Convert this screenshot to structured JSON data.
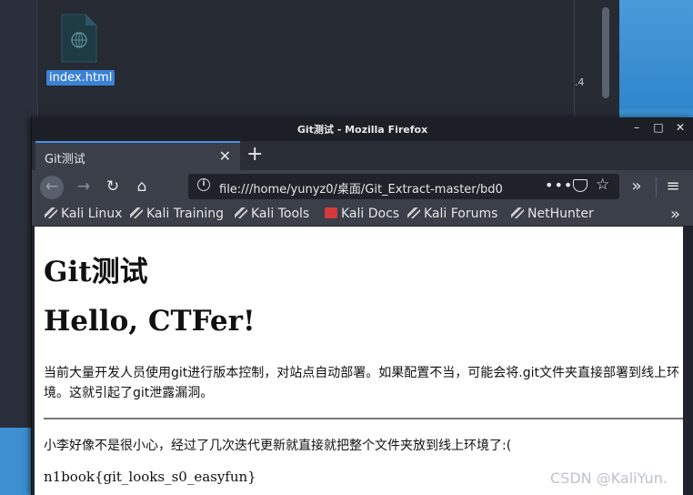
{
  "desktop": {
    "file_label": "index.html",
    "side_text": ".4"
  },
  "window": {
    "title": "Git测试 - Mozilla Firefox",
    "controls": {
      "minimize": "–",
      "maximize": "□",
      "close": "✕"
    }
  },
  "tabs": [
    {
      "label": "Git测试",
      "active": true
    }
  ],
  "tabbar": {
    "close_glyph": "✕",
    "new_tab_glyph": "+"
  },
  "navbar": {
    "back_glyph": "←",
    "forward_glyph": "→",
    "reload_glyph": "↻",
    "home_glyph": "⌂",
    "url": "file:///home/yunyz0/桌面/Git_Extract-master/bd0",
    "info_glyph": "i",
    "dots": "•••",
    "star_glyph": "☆",
    "overflow_glyph": "»",
    "menu_glyph": "≡"
  },
  "bookmarks": [
    {
      "label": "Kali Linux",
      "icon": "kali-dragon-icon"
    },
    {
      "label": "Kali Training",
      "icon": "kali-dragon-icon"
    },
    {
      "label": "Kali Tools",
      "icon": "kali-dragon-icon"
    },
    {
      "label": "Kali Docs",
      "icon": "kali-docs-icon"
    },
    {
      "label": "Kali Forums",
      "icon": "kali-dragon-icon"
    },
    {
      "label": "NetHunter",
      "icon": "kali-dragon-icon"
    }
  ],
  "bookmarks_more_glyph": "»",
  "page": {
    "heading1": "Git测试",
    "heading2": "Hello, CTFer!",
    "intro": "当前大量开发人员使用git进行版本控制，对站点自动部署。如果配置不当，可能会将.git文件夹直接部署到线上环境。这就引起了git泄露漏洞。",
    "note": "小李好像不是很小心，经过了几次迭代更新就直接就把整个文件夹放到线上环境了:(",
    "flag": "n1book{git_looks_s0_easyfun}"
  },
  "watermark": "CSDN @KaliYun.",
  "colors": {
    "accent": "#4a8fe8",
    "selection": "#3b82d6",
    "toolbar": "#3a3f49",
    "titlebar": "#1c1f26"
  }
}
